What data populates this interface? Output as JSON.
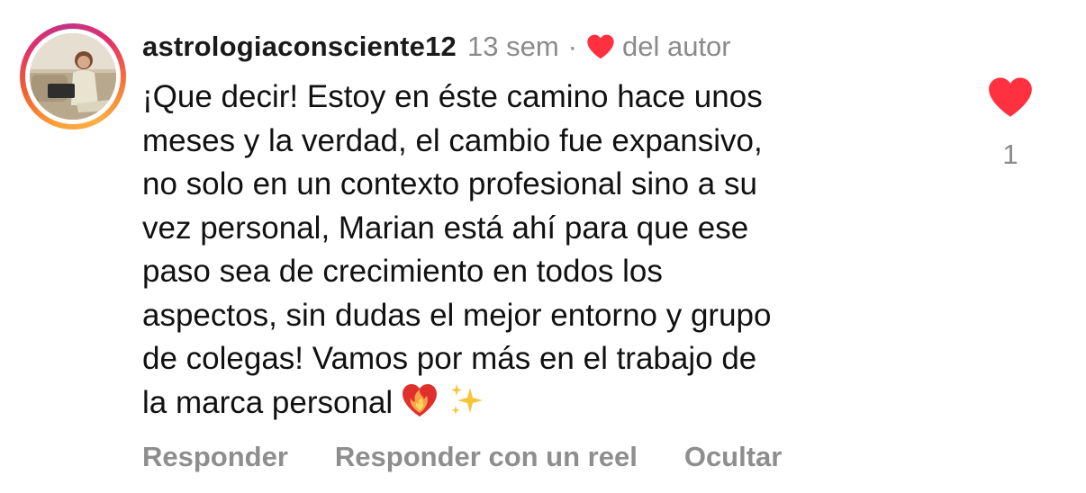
{
  "comment": {
    "username": "astrologiaconsciente12",
    "time": "13 sem",
    "separator": "·",
    "author_liked_label": "del autor",
    "text_lines": [
      "¡Que decir! Estoy en éste camino hace unos",
      "meses y la verdad, el cambio fue expansivo,",
      "no solo en un contexto profesional sino a su",
      "vez personal, Marian está ahí para que ese",
      "paso sea de crecimiento en todos los",
      "aspectos, sin dudas el mejor entorno y grupo",
      "de colegas! Vamos por más en el trabajo de",
      "la marca personal"
    ],
    "emojis": [
      "heart-on-fire-emoji",
      "sparkles-emoji"
    ],
    "like_count": "1",
    "liked": true
  },
  "actions": {
    "reply_label": "Responder",
    "reply_reel_label": "Responder con un reel",
    "hide_label": "Ocultar"
  },
  "colors": {
    "like_red": "#ff3040",
    "muted_gray": "#8e8e8e",
    "text": "#111111"
  }
}
